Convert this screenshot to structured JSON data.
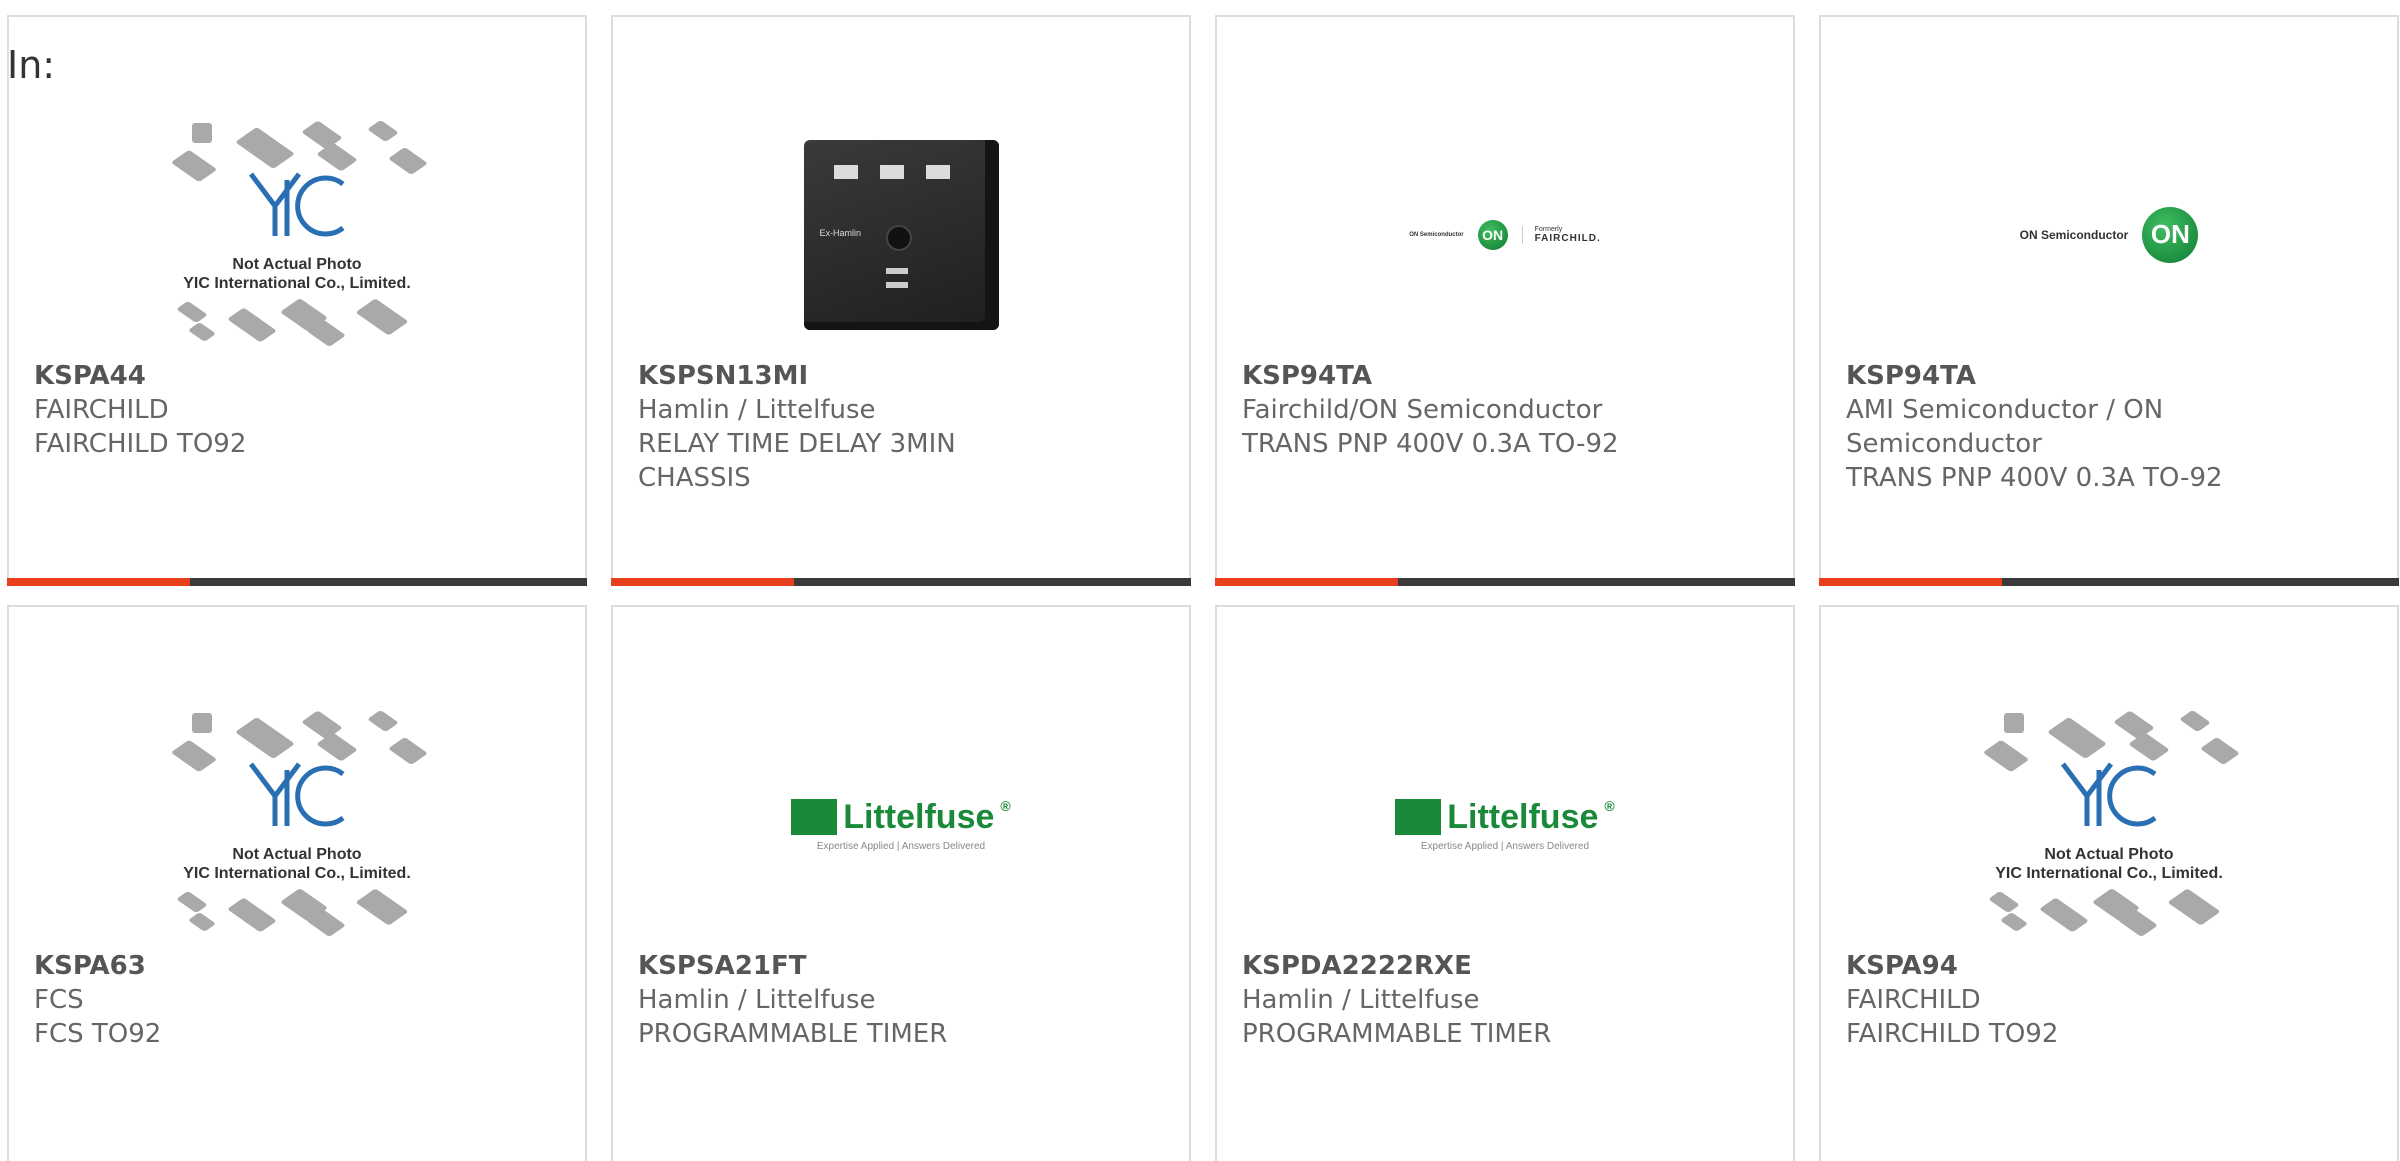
{
  "page": {
    "in_label": "In:"
  },
  "products": [
    {
      "part": "KSPA44",
      "maker": "FAIRCHILD",
      "desc": [
        "FAIRCHILD TO92"
      ],
      "image": "yic-placeholder"
    },
    {
      "part": "KSPSN13MI",
      "maker": "Hamlin / Littelfuse",
      "desc": [
        "RELAY TIME DELAY 3MIN",
        "CHASSIS"
      ],
      "image": "relay-photo"
    },
    {
      "part": "KSP94TA",
      "maker": "Fairchild/ON Semiconductor",
      "desc": [
        "TRANS PNP 400V 0.3A TO-92"
      ],
      "image": "on-fairchild-logo"
    },
    {
      "part": "KSP94TA",
      "maker": "AMI Semiconductor / ON",
      "maker2": "Semiconductor",
      "desc": [
        "TRANS PNP 400V 0.3A TO-92"
      ],
      "image": "on-semi-logo"
    },
    {
      "part": "KSPA63",
      "maker": "FCS",
      "desc": [
        "FCS TO92"
      ],
      "image": "yic-placeholder"
    },
    {
      "part": "KSPSA21FT",
      "maker": "Hamlin / Littelfuse",
      "desc": [
        "PROGRAMMABLE TIMER"
      ],
      "image": "littelfuse-logo"
    },
    {
      "part": "KSPDA2222RXE",
      "maker": "Hamlin / Littelfuse",
      "desc": [
        "PROGRAMMABLE TIMER"
      ],
      "image": "littelfuse-logo"
    },
    {
      "part": "KSPA94",
      "maker": "FAIRCHILD",
      "desc": [
        "FAIRCHILD TO92"
      ],
      "image": "yic-placeholder"
    }
  ],
  "yic": {
    "logo": "YIC",
    "line1": "Not Actual Photo",
    "line2": "YIC International Co., Limited."
  },
  "littelfuse": {
    "name": "Littelfuse",
    "registered": "®",
    "tagline": "Expertise Applied | Answers Delivered"
  },
  "on_semi": {
    "word": "ON Semiconductor",
    "registered": "®",
    "mark": "ON",
    "formerly": "Formerly",
    "fairchild": "FAIRCHILD."
  },
  "relay": {
    "brand": "Ex-Hamlin"
  },
  "colors": {
    "accent": "#e8401c",
    "bar": "#3a3a3a",
    "green": "#1a8a3a"
  }
}
